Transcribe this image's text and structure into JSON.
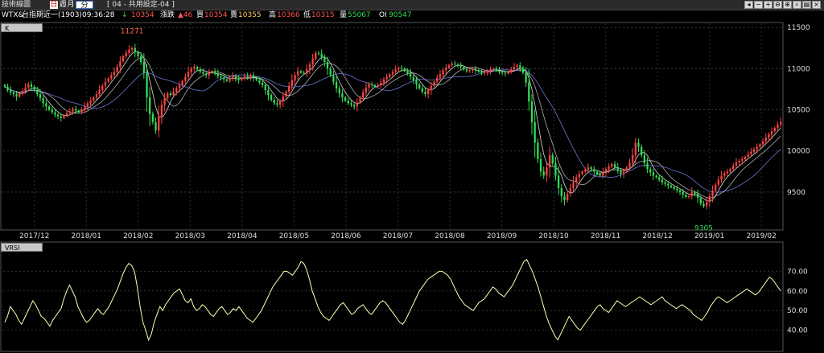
{
  "window": {
    "title": "技術線圖",
    "period_selected": "日",
    "period_week": "週",
    "period_month": "月",
    "period_minute": "分",
    "layout_name": "[ 04 - 共用設定-04 ]"
  },
  "quote": {
    "symbol": "WTX&",
    "name": "台指期近一(1903)",
    "time": "09:36:28",
    "arrow": "↓",
    "last": "10354",
    "change_label": "漲跌",
    "change": "▲46",
    "buy_label": "買",
    "buy": "10354",
    "sell_label": "賣",
    "sell": "10355",
    "high_label": "高",
    "high": "10366",
    "low_label": "低",
    "low": "10315",
    "vol_label": "量",
    "vol": "55067",
    "oi_label": "OI",
    "oi": "90547"
  },
  "colors": {
    "up": "#ff4444",
    "down": "#33dd55",
    "ma1": "#ffffff",
    "ma2": "#7f8cff",
    "ma3": "#cccccc",
    "rsi": "#ffffb0",
    "annot_hi": "#ff6644",
    "annot_lo": "#33dd55"
  },
  "chart_data": [
    {
      "type": "candlestick",
      "title": "K",
      "ylim": [
        9050,
        11550
      ],
      "yticks": [
        9500,
        10000,
        10500,
        11000,
        11500
      ],
      "xlabels": [
        "2017/12",
        "2018/01",
        "2018/02",
        "2018/03",
        "2018/04",
        "2018/05",
        "2018/06",
        "2018/07",
        "2018/08",
        "2018/09",
        "2018/10",
        "2018/11",
        "2018/12",
        "2019/01",
        "2019/02"
      ],
      "annotations": [
        {
          "text": "11271",
          "at": "high"
        },
        {
          "text": "9305",
          "at": "low"
        }
      ],
      "closes": [
        10780,
        10740,
        10710,
        10690,
        10660,
        10700,
        10730,
        10770,
        10810,
        10780,
        10740,
        10690,
        10640,
        10580,
        10540,
        10500,
        10470,
        10440,
        10420,
        10400,
        10430,
        10460,
        10480,
        10510,
        10490,
        10470,
        10500,
        10540,
        10580,
        10610,
        10650,
        10690,
        10740,
        10790,
        10840,
        10880,
        10920,
        10960,
        11020,
        11090,
        11150,
        11190,
        11230,
        11250,
        11200,
        11150,
        11080,
        10950,
        10650,
        10450,
        10350,
        10250,
        10420,
        10560,
        10640,
        10700,
        10680,
        10720,
        10760,
        10800,
        10850,
        10900,
        10960,
        11000,
        11020,
        10990,
        10960,
        10940,
        10920,
        10950,
        10970,
        10940,
        10910,
        10890,
        10870,
        10850,
        10880,
        10910,
        10880,
        10860,
        10880,
        10910,
        10890,
        10920,
        10890,
        10860,
        10830,
        10800,
        10740,
        10680,
        10620,
        10580,
        10560,
        10600,
        10660,
        10720,
        10790,
        10860,
        10920,
        10970,
        10950,
        10940,
        10990,
        11050,
        11120,
        11190,
        11180,
        11140,
        11080,
        11000,
        10920,
        10840,
        10760,
        10700,
        10650,
        10610,
        10580,
        10560,
        10540,
        10590,
        10650,
        10710,
        10770,
        10810,
        10800,
        10780,
        10800,
        10830,
        10870,
        10900,
        10930,
        10960,
        10990,
        11010,
        11000,
        10970,
        10940,
        10900,
        10860,
        10810,
        10760,
        10720,
        10690,
        10740,
        10790,
        10840,
        10890,
        10930,
        10980,
        11010,
        11040,
        11060,
        11050,
        11040,
        11020,
        10990,
        10970,
        10980,
        11000,
        10980,
        10960,
        10940,
        10950,
        10970,
        10990,
        11000,
        10980,
        10960,
        10950,
        10940,
        10960,
        10990,
        11020,
        11040,
        11010,
        10950,
        10830,
        10600,
        10350,
        10100,
        9900,
        9750,
        9700,
        9800,
        9950,
        9850,
        9700,
        9550,
        9450,
        9400,
        9480,
        9550,
        9620,
        9680,
        9720,
        9750,
        9770,
        9800,
        9780,
        9750,
        9720,
        9700,
        9740,
        9780,
        9810,
        9840,
        9800,
        9760,
        9720,
        9750,
        9800,
        9860,
        9950,
        10100,
        10050,
        9950,
        9850,
        9780,
        9740,
        9700,
        9680,
        9650,
        9620,
        9600,
        9580,
        9560,
        9540,
        9520,
        9500,
        9470,
        9440,
        9450,
        9500,
        9480,
        9430,
        9360,
        9330,
        9380,
        9450,
        9520,
        9590,
        9650,
        9700,
        9730,
        9750,
        9780,
        9820,
        9860,
        9880,
        9900,
        9930,
        9960,
        9990,
        10020,
        10050,
        10080,
        10120,
        10160,
        10200,
        10240,
        10280,
        10320,
        10354
      ]
    },
    {
      "type": "line",
      "title": "VRSI",
      "ylim": [
        30,
        80
      ],
      "yticks": [
        40,
        50,
        60,
        70
      ],
      "ytick_labels": [
        "40.00",
        "50.00",
        "60.00",
        "70.00"
      ],
      "values": [
        44,
        47,
        52,
        50,
        48,
        45,
        43,
        46,
        49,
        52,
        55,
        53,
        50,
        47,
        46,
        44,
        42,
        45,
        47,
        49,
        51,
        56,
        60,
        63,
        60,
        57,
        52,
        49,
        46,
        44,
        45,
        47,
        49,
        51,
        49,
        48,
        50,
        52,
        55,
        58,
        61,
        65,
        69,
        72,
        74,
        73,
        70,
        62,
        52,
        44,
        40,
        35,
        38,
        44,
        48,
        52,
        50,
        53,
        55,
        57,
        59,
        60,
        61,
        58,
        55,
        54,
        56,
        52,
        50,
        51,
        53,
        52,
        50,
        48,
        47,
        49,
        51,
        52,
        50,
        48,
        49,
        51,
        50,
        52,
        50,
        48,
        46,
        45,
        44,
        46,
        48,
        50,
        53,
        56,
        59,
        62,
        64,
        66,
        68,
        70,
        70,
        69,
        68,
        70,
        72,
        75,
        74,
        71,
        66,
        60,
        56,
        52,
        49,
        47,
        46,
        45,
        47,
        49,
        51,
        53,
        54,
        52,
        50,
        48,
        49,
        51,
        52,
        53,
        51,
        49,
        48,
        50,
        52,
        54,
        55,
        54,
        52,
        50,
        48,
        46,
        44,
        43,
        45,
        48,
        51,
        54,
        57,
        60,
        62,
        64,
        66,
        67,
        68,
        69,
        70,
        70,
        69,
        68,
        66,
        63,
        60,
        57,
        55,
        53,
        52,
        51,
        50,
        52,
        54,
        55,
        56,
        58,
        60,
        62,
        61,
        59,
        58,
        57,
        59,
        61,
        63,
        66,
        69,
        72,
        75,
        76,
        73,
        70,
        66,
        62,
        57,
        52,
        47,
        43,
        40,
        37,
        35,
        38,
        41,
        44,
        47,
        45,
        43,
        41,
        40,
        42,
        44,
        46,
        48,
        50,
        52,
        53,
        51,
        50,
        49,
        51,
        53,
        55,
        54,
        53,
        52,
        53,
        54,
        55,
        56,
        57,
        56,
        55,
        54,
        53,
        54,
        55,
        56,
        57,
        55,
        54,
        53,
        52,
        51,
        52,
        53,
        52,
        51,
        50,
        48,
        47,
        46,
        45,
        47,
        49,
        52,
        54,
        56,
        57,
        56,
        55,
        54,
        55,
        56,
        57,
        58,
        59,
        60,
        61,
        60,
        59,
        58,
        59,
        61,
        63,
        65,
        67,
        66,
        64,
        62,
        60
      ]
    }
  ]
}
